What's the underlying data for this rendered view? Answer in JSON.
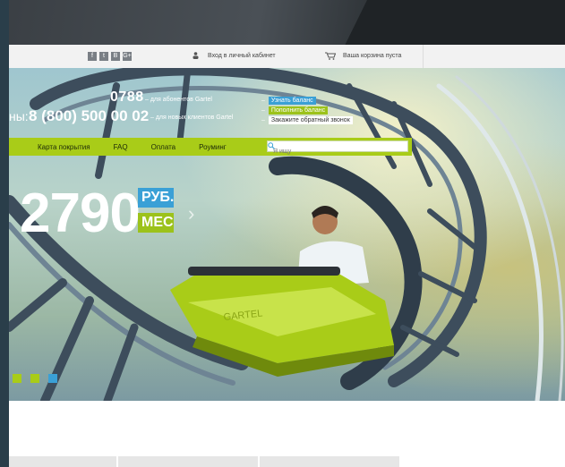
{
  "social": {
    "icons": [
      "f",
      "t",
      "B",
      "G+"
    ]
  },
  "account": {
    "login_label": "Вход в личный кабинет",
    "cart_label": "Ваша корзина пуста"
  },
  "contacts": {
    "short_number": "0788",
    "short_desc": "– для абонентов Gartel",
    "long_label": "ны:",
    "long_number": "8 (800) 500 00 02",
    "long_desc": "– для новых клиентов Gartel"
  },
  "quick_links": [
    {
      "label": "Узнать баланс"
    },
    {
      "label": "Пополнить баланс"
    },
    {
      "label": "Закажите обратный звонок"
    }
  ],
  "nav": {
    "items": [
      "Карта покрытия",
      "FAQ",
      "Оплата",
      "Роуминг"
    ],
    "search_placeholder": "Я ищу"
  },
  "promo": {
    "price": "2790",
    "currency": "РУБ.",
    "period": "МЕС"
  },
  "slider": {
    "dots": [
      "#a9cc18",
      "#a9cc18",
      "#3aa0d6"
    ]
  },
  "colors": {
    "accent_green": "#a9cc18",
    "accent_blue": "#3aa0d6"
  }
}
